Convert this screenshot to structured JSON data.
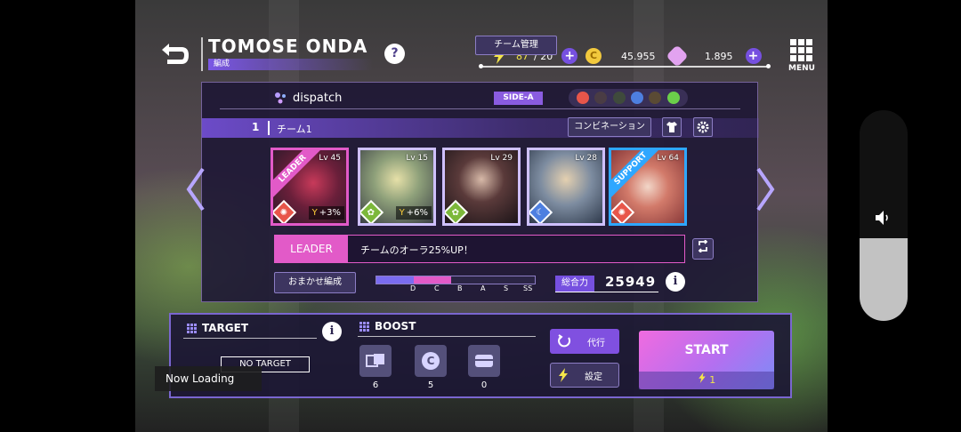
{
  "header": {
    "player_name": "TOMOSE ONDA",
    "sub_label": "編成",
    "help_label": "?",
    "stamina": {
      "current": "87",
      "max": "/ 20",
      "plus": "+"
    },
    "coins": {
      "icon": "C",
      "value": "45.955",
      "plus": "+"
    },
    "gems": {
      "value": "1.895",
      "plus": "+"
    },
    "menu_label": "MENU"
  },
  "panel": {
    "mode_label": "dispatch",
    "side_label": "SIDE-A",
    "attribute_icons": [
      "fire-icon",
      "dark-icon",
      "grass-icon",
      "water-icon",
      "earth-icon",
      "leaf-icon"
    ],
    "team_number": "1",
    "team_name": "チーム1",
    "team_manage_label": "チーム管理",
    "combination_label": "コンビネーション",
    "cards": [
      {
        "level": "Lv 45",
        "ribbon": "LEADER",
        "attribute": "fire",
        "attr_glyph": "✺",
        "bonus": "+3%"
      },
      {
        "level": "Lv 15",
        "ribbon": "",
        "attribute": "grass",
        "attr_glyph": "✿",
        "bonus": "+6%"
      },
      {
        "level": "Lv 29",
        "ribbon": "",
        "attribute": "grass",
        "attr_glyph": "✿",
        "bonus": ""
      },
      {
        "level": "Lv 28",
        "ribbon": "",
        "attribute": "water",
        "attr_glyph": "☾",
        "bonus": ""
      },
      {
        "level": "Lv 64",
        "ribbon": "SUPPORT",
        "attribute": "fire",
        "attr_glyph": "✺",
        "bonus": ""
      }
    ],
    "leader_tag": "LEADER",
    "leader_skill": "チームのオーラ25%UP！",
    "auto_label": "おまかせ編成",
    "rank_letters": [
      "D",
      "C",
      "B",
      "A",
      "S",
      "SS"
    ],
    "power_label": "総合力",
    "power_value": "25949",
    "info_glyph": "i"
  },
  "bottom": {
    "target_title": "TARGET",
    "no_target": "NO TARGET",
    "boost_title": "BOOST",
    "boosts": [
      {
        "icon": "ticket-icon",
        "count": "6"
      },
      {
        "icon": "coin-icon",
        "count": "5"
      },
      {
        "icon": "chest-icon",
        "count": "0"
      }
    ],
    "proxy_label": "代行",
    "settings_label": "設定",
    "start_label": "START",
    "start_cost": "1"
  },
  "loading_text": "Now Loading",
  "colors": {
    "accent": "#7650e0",
    "leader": "#e25ac8",
    "support": "#2ea7ff",
    "panel": "#1c1634"
  }
}
